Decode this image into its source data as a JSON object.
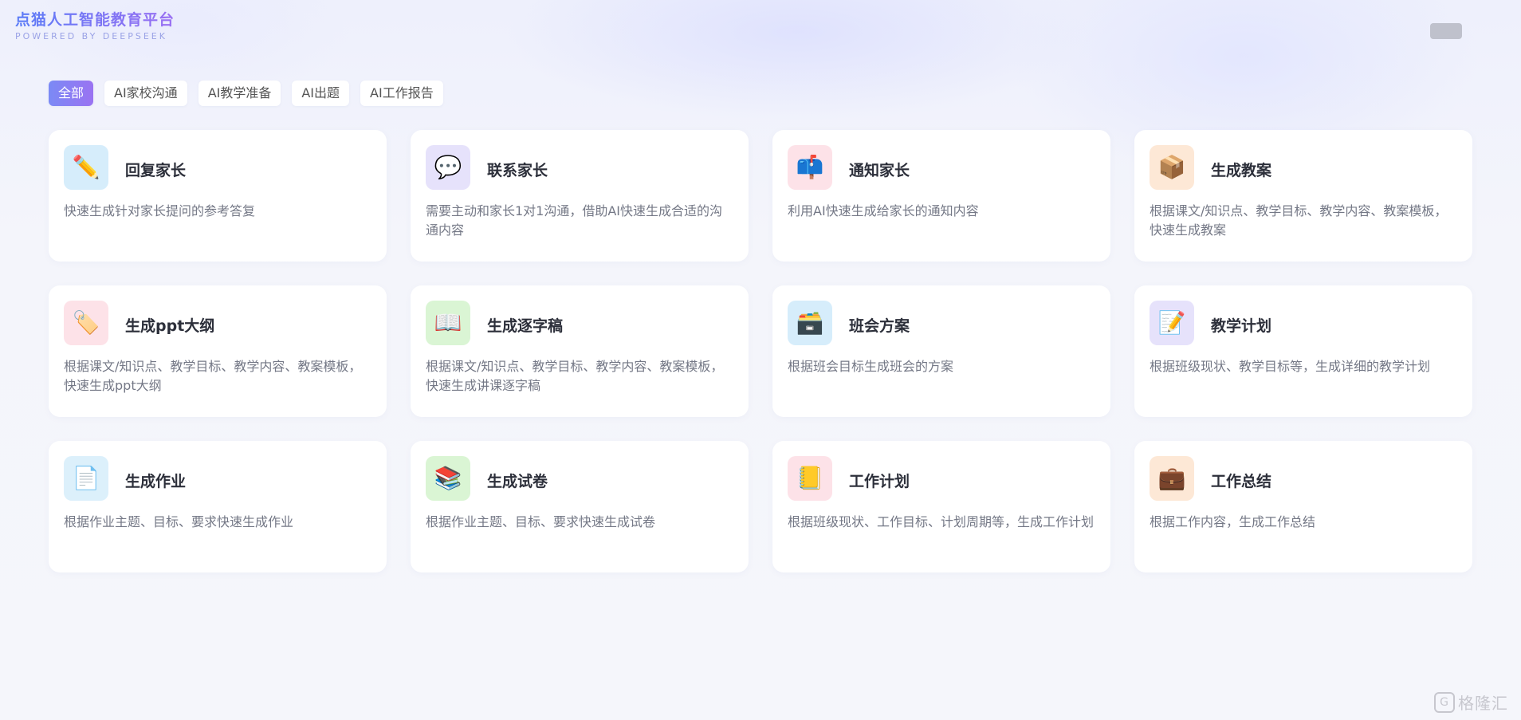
{
  "brand": {
    "title": "点猫人工智能教育平台",
    "subtitle": "POWERED BY DEEPSEEK"
  },
  "filters": [
    {
      "label": "全部",
      "active": true
    },
    {
      "label": "AI家校沟通",
      "active": false
    },
    {
      "label": "AI教学准备",
      "active": false
    },
    {
      "label": "AI出题",
      "active": false
    },
    {
      "label": "AI工作报告",
      "active": false
    }
  ],
  "cards": [
    {
      "title": "回复家长",
      "desc": "快速生成针对家长提问的参考答复",
      "icon": "pencil-icon",
      "glyph": "✏️",
      "color": "blue"
    },
    {
      "title": "联系家长",
      "desc": "需要主动和家长1对1沟通，借助AI快速生成合适的沟通内容",
      "icon": "speech-bubble-icon",
      "glyph": "💬",
      "color": "purple"
    },
    {
      "title": "通知家长",
      "desc": "利用AI快速生成给家长的通知内容",
      "icon": "mailbox-icon",
      "glyph": "📫",
      "color": "pink"
    },
    {
      "title": "生成教案",
      "desc": "根据课文/知识点、教学目标、教学内容、教案模板，快速生成教案",
      "icon": "box-icon",
      "glyph": "📦",
      "color": "orange"
    },
    {
      "title": "生成ppt大纲",
      "desc": "根据课文/知识点、教学目标、教学内容、教案模板，快速生成ppt大纲",
      "icon": "tag-icon",
      "glyph": "🏷️",
      "color": "pink"
    },
    {
      "title": "生成逐字稿",
      "desc": "根据课文/知识点、教学目标、教学内容、教案模板，快速生成讲课逐字稿",
      "icon": "book-icon",
      "glyph": "📖",
      "color": "green"
    },
    {
      "title": "班会方案",
      "desc": "根据班会目标生成班会的方案",
      "icon": "file-cabinet-icon",
      "glyph": "🗃️",
      "color": "blue"
    },
    {
      "title": "教学计划",
      "desc": "根据班级现状、教学目标等，生成详细的教学计划",
      "icon": "memo-icon",
      "glyph": "📝",
      "color": "purple"
    },
    {
      "title": "生成作业",
      "desc": "根据作业主题、目标、要求快速生成作业",
      "icon": "document-icon",
      "glyph": "📄",
      "color": "lblue"
    },
    {
      "title": "生成试卷",
      "desc": "根据作业主题、目标、要求快速生成试卷",
      "icon": "books-icon",
      "glyph": "📚",
      "color": "green"
    },
    {
      "title": "工作计划",
      "desc": "根据班级现状、工作目标、计划周期等，生成工作计划",
      "icon": "notebook-icon",
      "glyph": "📒",
      "color": "pink"
    },
    {
      "title": "工作总结",
      "desc": "根据工作内容，生成工作总结",
      "icon": "briefcase-icon",
      "glyph": "💼",
      "color": "orange"
    }
  ],
  "watermark": {
    "mark": "G",
    "text": "格隆汇"
  }
}
